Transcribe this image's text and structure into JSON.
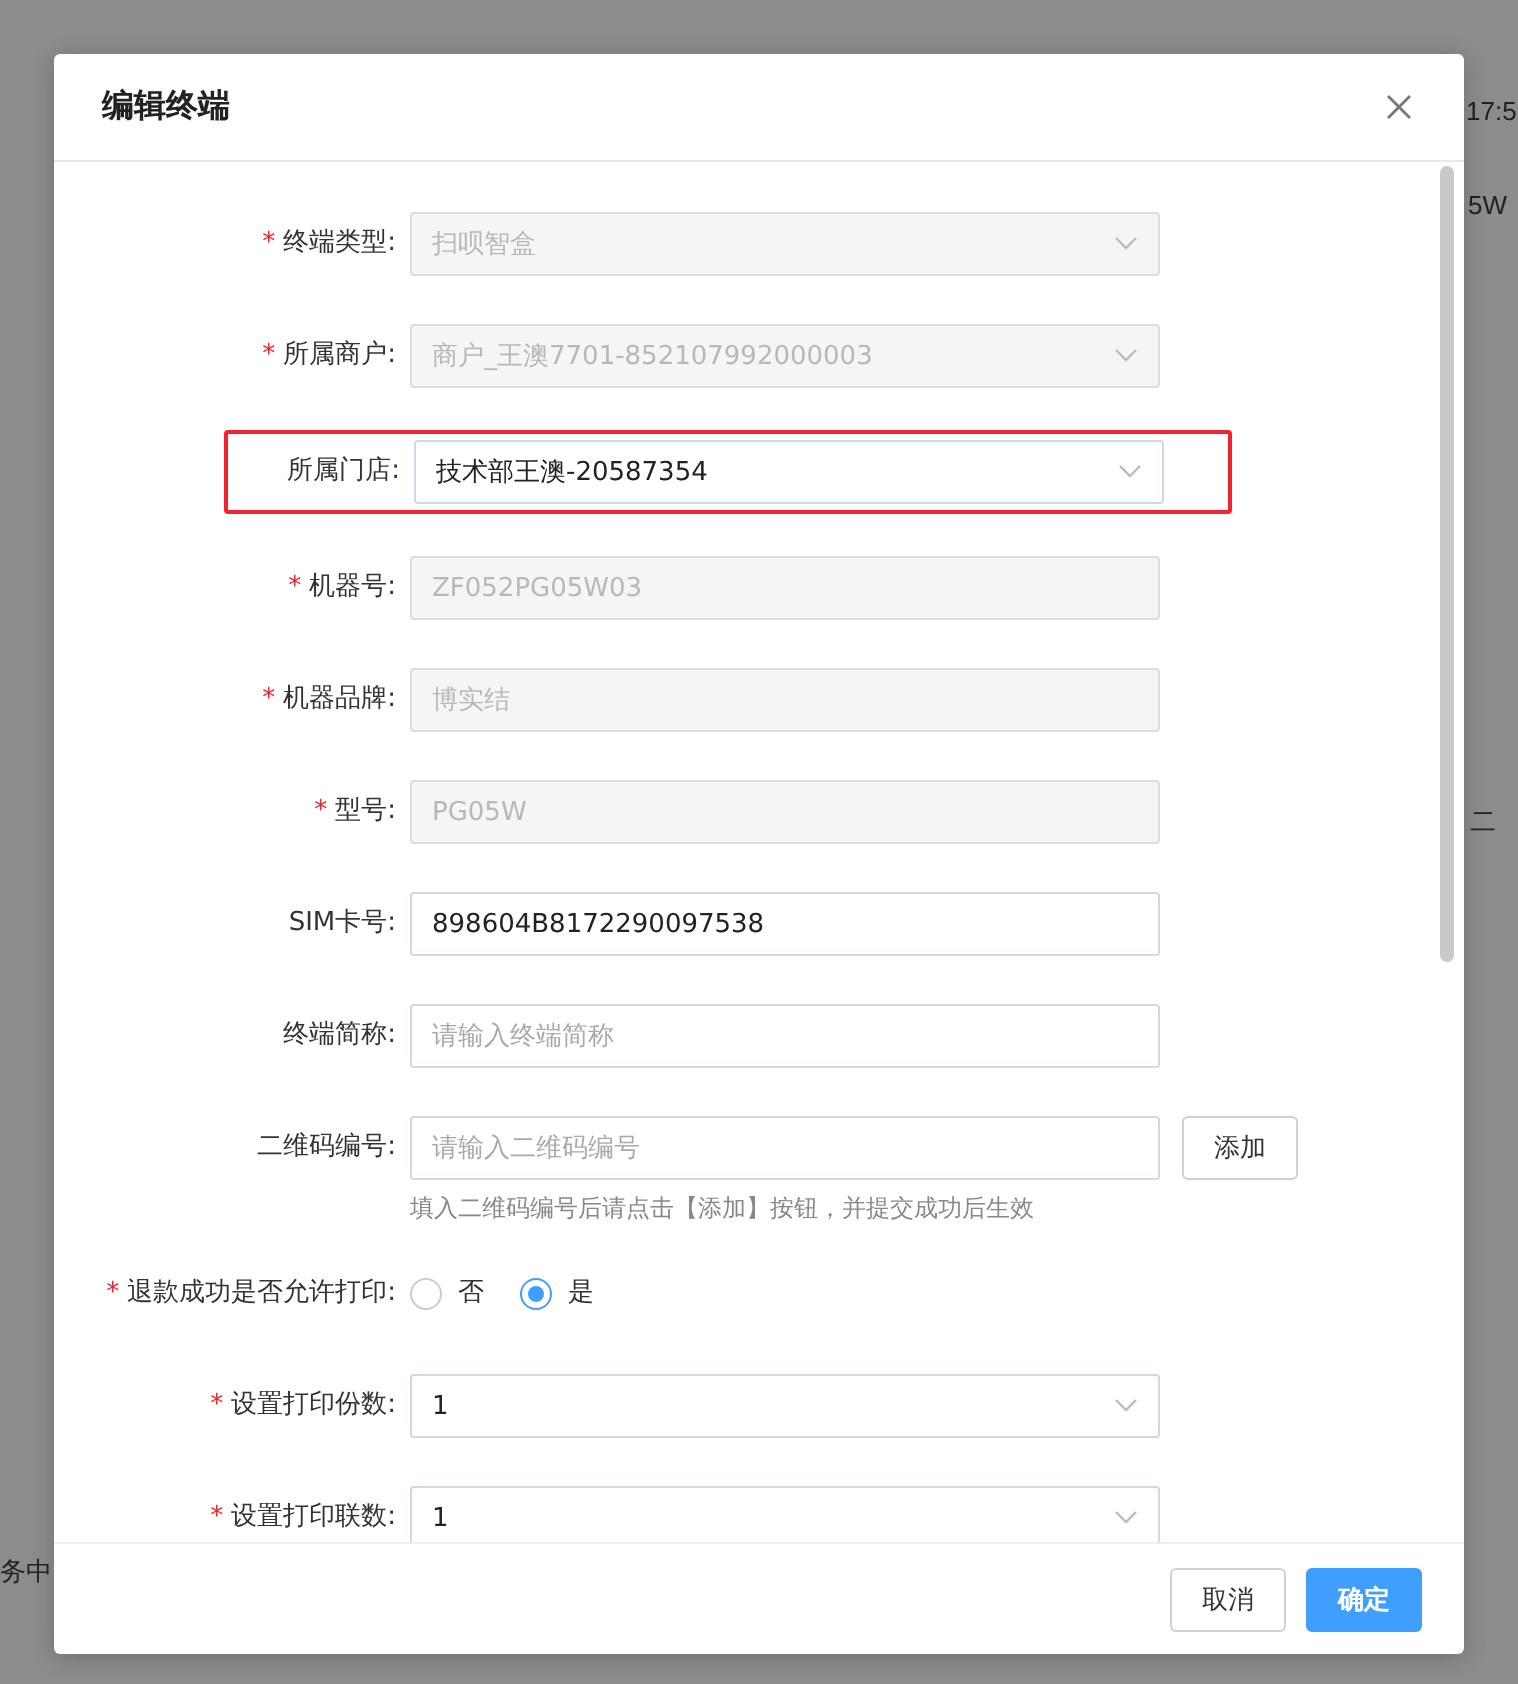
{
  "background": {
    "texts": [
      "17:5",
      "5W",
      "二",
      "务中"
    ]
  },
  "dialog": {
    "title": "编辑终端",
    "fields": [
      {
        "kind": "select",
        "required_mark": "*",
        "label": "终端类型:",
        "value": "扫呗智盒",
        "disabled": true,
        "highlighted": false
      },
      {
        "kind": "select",
        "required_mark": "*",
        "label": "所属商户:",
        "value": "商户_王澳7701-852107992000003",
        "disabled": true,
        "highlighted": false
      },
      {
        "kind": "select",
        "label": "所属门店:",
        "value": "技术部王澳-20587354",
        "disabled": false,
        "highlighted": true
      },
      {
        "kind": "input",
        "required_mark": "*",
        "label": "机器号:",
        "value": "ZF052PG05W03",
        "disabled": true,
        "highlighted": false
      },
      {
        "kind": "input",
        "required_mark": "*",
        "label": "机器品牌:",
        "value": "博实结",
        "disabled": true,
        "highlighted": false
      },
      {
        "kind": "input",
        "required_mark": "*",
        "label": "型号:",
        "value": "PG05W",
        "disabled": true,
        "highlighted": false
      },
      {
        "kind": "input",
        "label": "SIM卡号:",
        "value": "898604B8172290097538",
        "disabled": false,
        "highlighted": false
      },
      {
        "kind": "input",
        "label": "终端简称:",
        "placeholder": "请输入终端简称",
        "disabled": false,
        "highlighted": false
      },
      {
        "kind": "input",
        "label": "二维码编号:",
        "placeholder": "请输入二维码编号",
        "disabled": false,
        "highlighted": false,
        "button": "添加",
        "hint": "填入二维码编号后请点击【添加】按钮，并提交成功后生效"
      },
      {
        "kind": "radio",
        "required_mark": "*",
        "label": "退款成功是否允许打印:",
        "highlighted": false,
        "options": [
          {
            "label": "否",
            "selected": false
          },
          {
            "label": "是",
            "selected": true
          }
        ]
      },
      {
        "kind": "select",
        "required_mark": "*",
        "label": "设置打印份数:",
        "value": "1",
        "disabled": false,
        "highlighted": false
      },
      {
        "kind": "select",
        "required_mark": "*",
        "label": "设置打印联数:",
        "value": "1",
        "disabled": false,
        "highlighted": false
      }
    ],
    "buttons": [
      {
        "label": "取消",
        "kind": "default"
      },
      {
        "label": "确定",
        "kind": "primary"
      }
    ]
  }
}
